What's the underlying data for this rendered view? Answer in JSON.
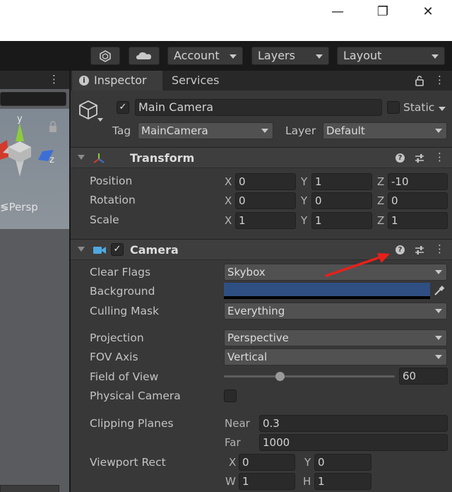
{
  "window": {
    "minimize_glyph": "—",
    "restore_glyph": "❐",
    "close_glyph": "✕"
  },
  "toolbar": {
    "account_label": "Account",
    "layers_label": "Layers",
    "layout_label": "Layout",
    "icons": [
      "plastic-scm-icon",
      "cloud-icon"
    ]
  },
  "scene": {
    "view_label": "≶Persp",
    "axis_y": "y",
    "axis_z": "z"
  },
  "inspector": {
    "tabs": [
      {
        "label": "Inspector"
      },
      {
        "label": "Services"
      }
    ],
    "object": {
      "active": "✓",
      "name": "Main Camera",
      "static_label": "Static",
      "tag_label": "Tag",
      "tag_value": "MainCamera",
      "layer_label": "Layer",
      "layer_value": "Default"
    },
    "transform": {
      "title": "Transform",
      "rows": [
        {
          "label": "Position",
          "x": "0",
          "y": "1",
          "z": "-10"
        },
        {
          "label": "Rotation",
          "x": "0",
          "y": "0",
          "z": "0"
        },
        {
          "label": "Scale",
          "x": "1",
          "y": "1",
          "z": "1"
        }
      ],
      "axis_x": "X",
      "axis_y": "Y",
      "axis_z": "Z"
    },
    "camera": {
      "title": "Camera",
      "enabled": "✓",
      "clear_flags": {
        "label": "Clear Flags",
        "value": "Skybox"
      },
      "background": {
        "label": "Background",
        "color": "#2f4f82"
      },
      "culling_mask": {
        "label": "Culling Mask",
        "value": "Everything"
      },
      "projection": {
        "label": "Projection",
        "value": "Perspective"
      },
      "fov_axis": {
        "label": "FOV Axis",
        "value": "Vertical"
      },
      "field_of_view": {
        "label": "Field of View",
        "value": "60",
        "slider_fraction": 0.33
      },
      "physical_camera": {
        "label": "Physical Camera"
      },
      "clipping_planes": {
        "label": "Clipping Planes",
        "near_label": "Near",
        "near": "0.3",
        "far_label": "Far",
        "far": "1000"
      },
      "viewport_rect": {
        "label": "Viewport Rect",
        "x_label": "X",
        "x": "0",
        "y_label": "Y",
        "y": "0",
        "w_label": "W",
        "w": "1",
        "h_label": "H",
        "h": "1"
      }
    }
  },
  "annotation": {
    "arrow_color": "#e8201a",
    "target": "help-icon"
  }
}
